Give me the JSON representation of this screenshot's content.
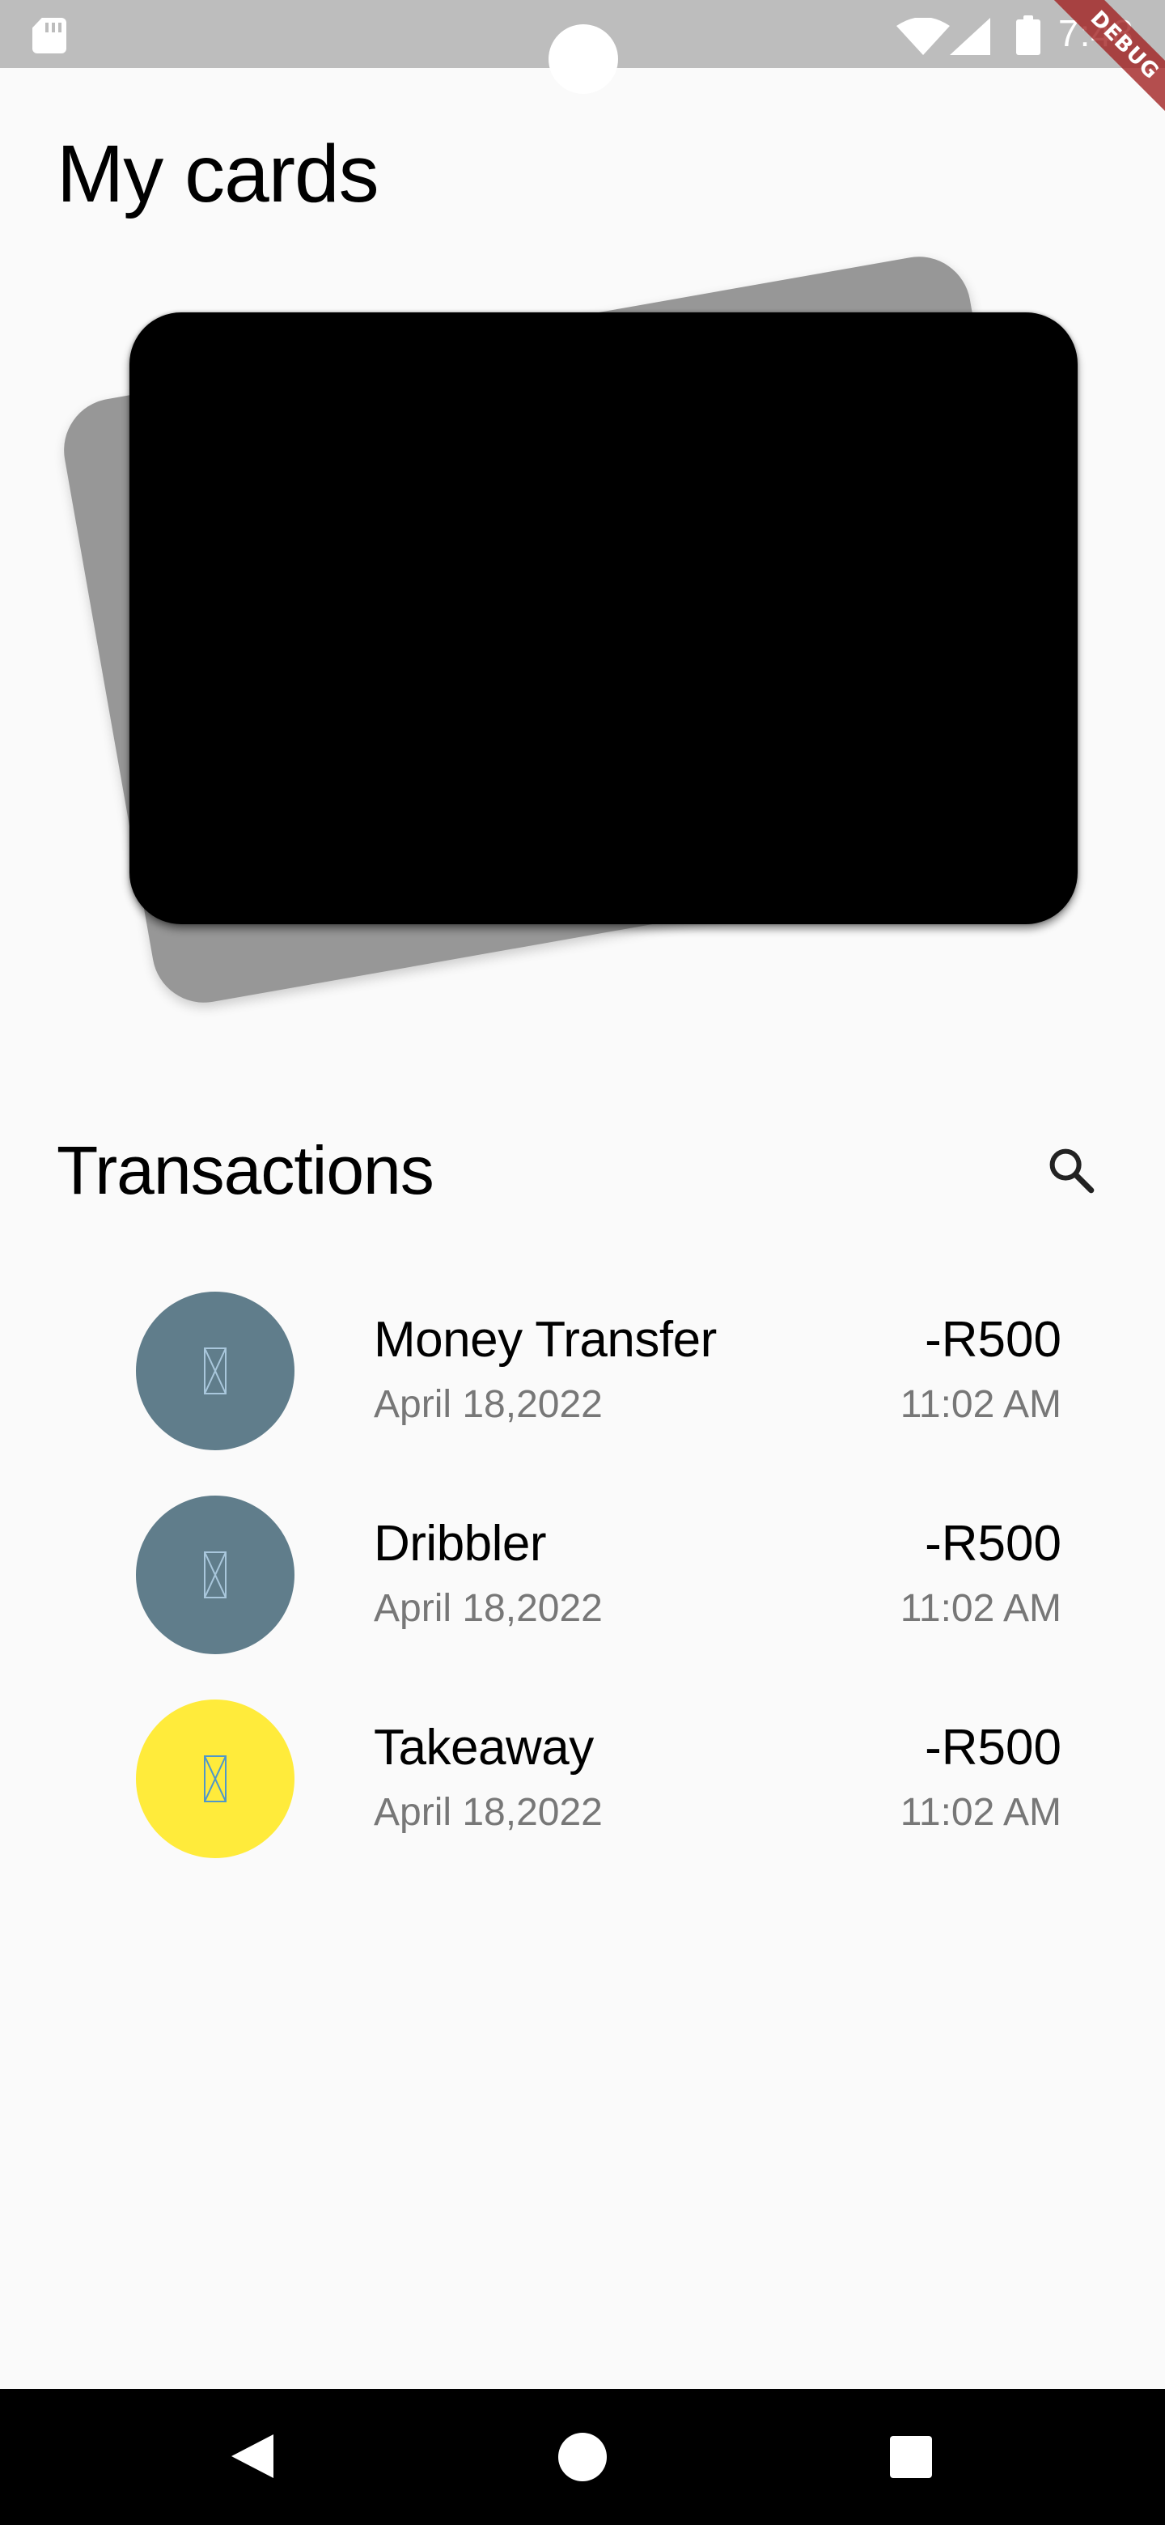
{
  "status_bar": {
    "time": "7:48",
    "debug_label": "DEBUG",
    "icons": [
      "sd-card-icon",
      "wifi-icon",
      "signal-icon",
      "battery-icon"
    ]
  },
  "page": {
    "title": "My cards"
  },
  "cards": {
    "front_color": "#000000",
    "back_color": "#979797"
  },
  "transactions": {
    "title": "Transactions",
    "search_icon": "search-icon",
    "items": [
      {
        "name": "Money Transfer",
        "date": "April 18,2022",
        "amount": "-R500",
        "time": "11:02 AM",
        "avatar_color": "#607d8b"
      },
      {
        "name": "Dribbler",
        "date": "April 18,2022",
        "amount": "-R500",
        "time": "11:02 AM",
        "avatar_color": "#607d8b"
      },
      {
        "name": "Takeaway",
        "date": "April 18,2022",
        "amount": "-R500",
        "time": "11:02 AM",
        "avatar_color": "#ffeb3b"
      }
    ]
  },
  "nav_bar": {
    "icons": [
      "back-icon",
      "home-icon",
      "recents-icon"
    ]
  }
}
